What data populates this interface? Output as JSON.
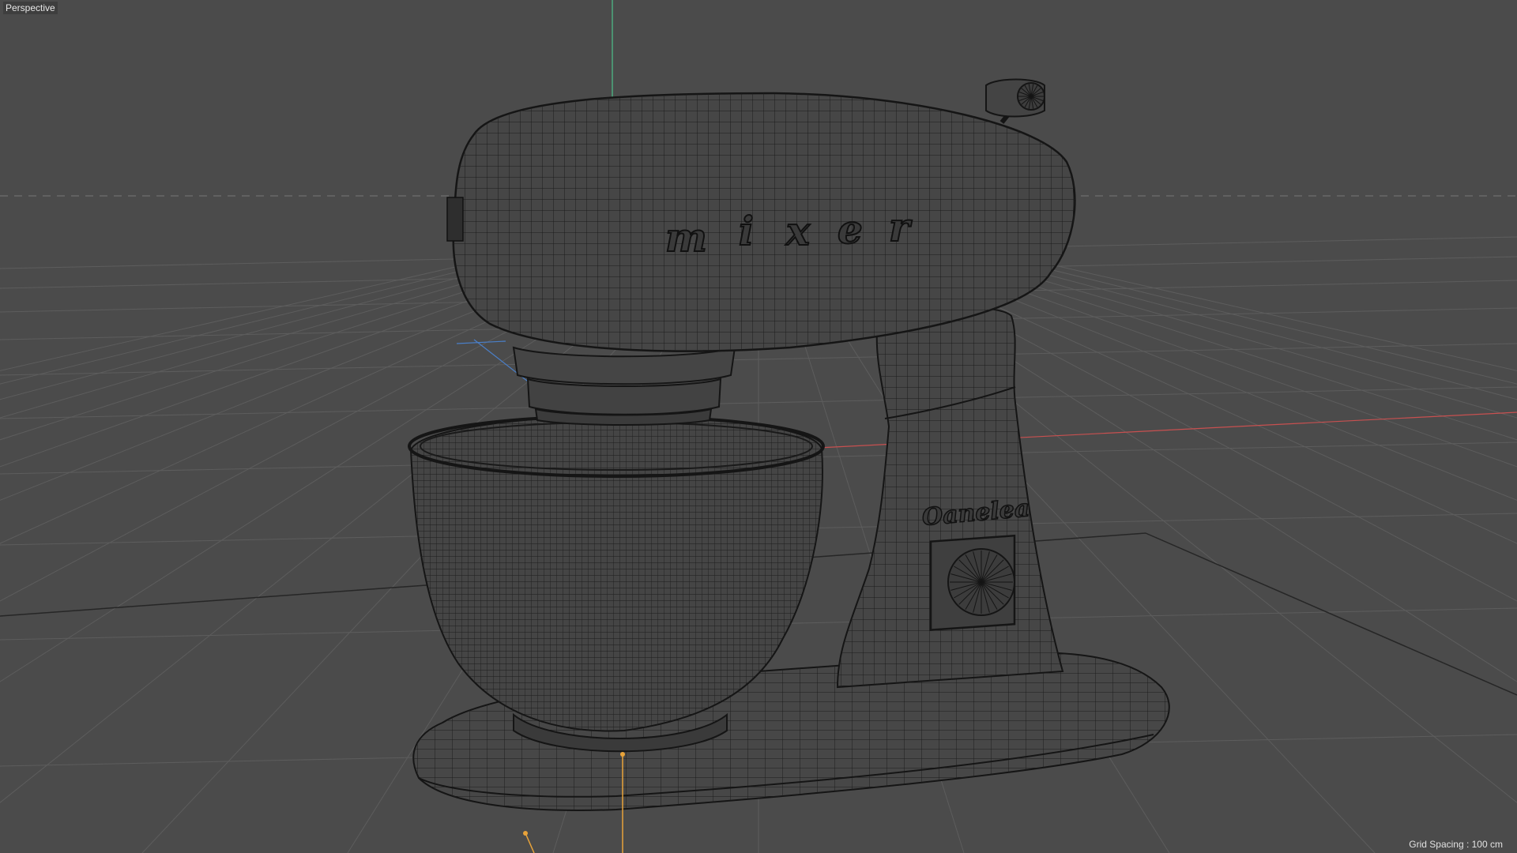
{
  "viewport": {
    "camera_label": "Perspective",
    "grid_readout": "Grid Spacing : 100 cm"
  },
  "model": {
    "head_lettering": [
      "m",
      "i",
      "x",
      "e",
      "r"
    ],
    "badge_lettering": "Oanelea"
  },
  "colors": {
    "background": "#4b4b4b",
    "grid_line": "#5e5e5e",
    "grid_major": "#2a2a2a",
    "wire": "#1e1e1e",
    "mesh_fill": "#444444",
    "axis_x": "#c85050",
    "axis_y": "#4ec28a",
    "axis_z": "#4a7fc8",
    "selection": "#e8a33a"
  },
  "icons": {
    "camera_menu": "perspective-camera",
    "world_axis": "xyz-axis-gizmo"
  }
}
